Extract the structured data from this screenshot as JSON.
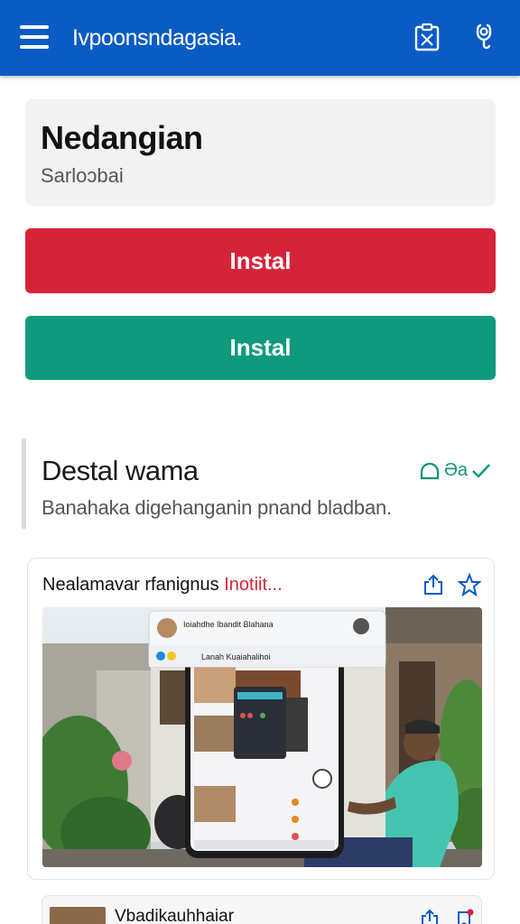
{
  "appbar": {
    "title": "Ivpoonsndagasia.",
    "icons": [
      "menu-icon",
      "clipboard-check-icon",
      "stethoscope-icon"
    ]
  },
  "info_card": {
    "title": "Nedangian",
    "subtitle": "Sarloɔbai"
  },
  "buttons": {
    "primary_label": "Instal",
    "secondary_label": "Instal",
    "colors": {
      "primary": "#d7233a",
      "secondary": "#0f9a7e"
    }
  },
  "section": {
    "title": "Destal wama",
    "description": "Banahaka digehanganin pnand bladban.",
    "action_label": "Əa",
    "action_icons": [
      "cloud-icon",
      "check-icon"
    ]
  },
  "feed": {
    "header_text": "Nealamavar rfanignus",
    "header_accent": "Inotiit...",
    "icons": [
      "share-icon",
      "star-icon"
    ],
    "image": {
      "phone_chat_title": "Ioiahdhe Ibandit Blahana",
      "phone_address": "Lanah Kuaiahalihoi"
    }
  },
  "feed2": {
    "title": "Vbadikauhhaiar",
    "icons": [
      "share-icon",
      "bookmark-icon"
    ]
  },
  "colors": {
    "appbar": "#0a5cc4",
    "accent_green": "#12957a"
  }
}
